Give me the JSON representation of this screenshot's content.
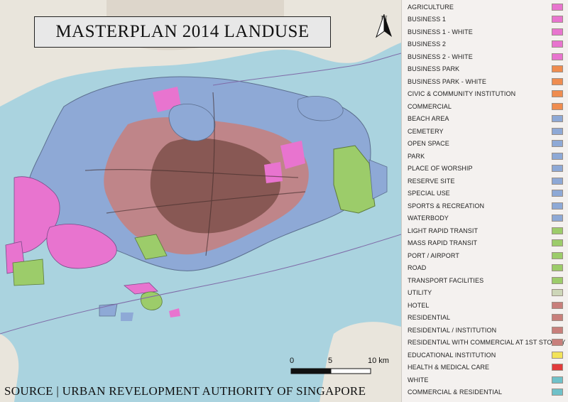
{
  "map": {
    "title": "MASTERPLAN 2014 LANDUSE",
    "north_label": "N",
    "source_text": "SOURCE | URBAN REVELOPMENT AUTHORITY OF SINGAPORE",
    "scale_labels": [
      "0",
      "5",
      "10 km"
    ],
    "colors": {
      "sea": "#aad3df",
      "land_base": "#e9e5dc",
      "urban": "#c87f7b",
      "dense_urban": "#7a4c47"
    }
  },
  "legend": {
    "items": [
      {
        "label": "AGRICULTURE",
        "color": "#e874cf"
      },
      {
        "label": "BUSINESS 1",
        "color": "#e874cf"
      },
      {
        "label": "BUSINESS 1 - WHITE",
        "color": "#e874cf"
      },
      {
        "label": "BUSINESS 2",
        "color": "#e874cf"
      },
      {
        "label": "BUSINESS 2 - WHITE",
        "color": "#e874cf"
      },
      {
        "label": "BUSINESS PARK",
        "color": "#ef8c4f"
      },
      {
        "label": "BUSINESS PARK - WHITE",
        "color": "#ef8c4f"
      },
      {
        "label": "CIVIC & COMMUNITY INSTITUTION",
        "color": "#ef8c4f"
      },
      {
        "label": "COMMERCIAL",
        "color": "#ef8c4f"
      },
      {
        "label": "BEACH AREA",
        "color": "#8ea9d6"
      },
      {
        "label": "CEMETERY",
        "color": "#8ea9d6"
      },
      {
        "label": "OPEN SPACE",
        "color": "#8ea9d6"
      },
      {
        "label": "PARK",
        "color": "#8ea9d6"
      },
      {
        "label": "PLACE OF WORSHIP",
        "color": "#8ea9d6"
      },
      {
        "label": "RESERVE SITE",
        "color": "#8ea9d6"
      },
      {
        "label": "SPECIAL USE",
        "color": "#8ea9d6"
      },
      {
        "label": "SPORTS & RECREATION",
        "color": "#8ea9d6"
      },
      {
        "label": "WATERBODY",
        "color": "#8ea9d6"
      },
      {
        "label": "LIGHT RAPID TRANSIT",
        "color": "#9ccc6a"
      },
      {
        "label": "MASS RAPID TRANSIT",
        "color": "#9ccc6a"
      },
      {
        "label": "PORT / AIRPORT",
        "color": "#9ccc6a"
      },
      {
        "label": "ROAD",
        "color": "#9ccc6a"
      },
      {
        "label": "TRANSPORT FACILITIES",
        "color": "#9ccc6a"
      },
      {
        "label": "UTILITY",
        "color": "#cdd6b8"
      },
      {
        "label": "HOTEL",
        "color": "#c87f7b"
      },
      {
        "label": "RESIDENTIAL",
        "color": "#c87f7b"
      },
      {
        "label": "RESIDENTIAL / INSTITUTION",
        "color": "#c87f7b"
      },
      {
        "label": "RESIDENTIAL WITH COMMERCIAL AT 1ST STOREY",
        "color": "#c87f7b"
      },
      {
        "label": "EDUCATIONAL INSTITUTION",
        "color": "#f2e35a"
      },
      {
        "label": "HEALTH & MEDICAL CARE",
        "color": "#e23b3b"
      },
      {
        "label": "WHITE",
        "color": "#6fc1c9"
      },
      {
        "label": "COMMERCIAL & RESIDENTIAL",
        "color": "#6fc1c9"
      }
    ]
  }
}
